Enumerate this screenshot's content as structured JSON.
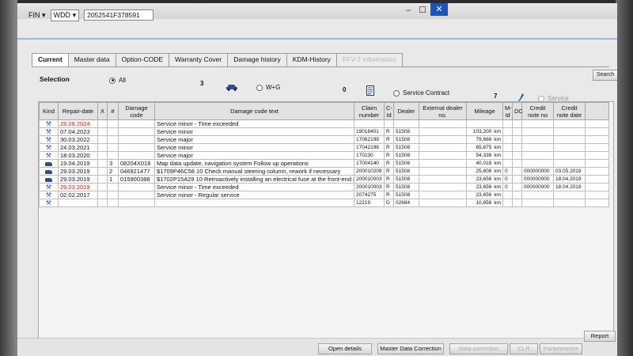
{
  "window": {
    "minimize": "–",
    "maximize": "☐",
    "close": "✕"
  },
  "vehicle": {
    "fin_label": "FIN",
    "wdd_value": "WDD",
    "vin": "2052541F378591"
  },
  "tabs": [
    "Current",
    "Master data",
    "Option-CODE",
    "Warranty Cover",
    "Damage history",
    "KDM-History",
    "FFV-T information"
  ],
  "active_tab": "Damage history",
  "selection": {
    "label": "Selection",
    "all": "All",
    "wg_count": "3",
    "wg_label": "W+G",
    "contract_count": "0",
    "contract_label": "Service Contract",
    "service_count": "7",
    "service_label": "Service"
  },
  "search_button": "Search",
  "table": {
    "headers": {
      "kind": "Kind",
      "repair_date": "Repair-date",
      "x": "X",
      "num": "#",
      "damage_code": "Damage code",
      "damage_text": "Damage code text",
      "claim": "Claim number",
      "cat": "C-Id",
      "dealer": "Dealer",
      "ext_dealer": "External dealer no.",
      "mileage": "Mileage",
      "m_id": "M-Id",
      "dc": "DC",
      "credit_note_no": "Credit note no",
      "credit_note_date": "Credit note date"
    },
    "rows": [
      {
        "kind": "service",
        "date": "28.08.2024",
        "date_red": true,
        "x": "",
        "num": "",
        "code": "",
        "text": "Service minor - Time exceeded",
        "claim": "",
        "cat": "",
        "dealer": "",
        "mileage": "",
        "unit": "",
        "mid": "",
        "credit_no": "",
        "credit_date": ""
      },
      {
        "kind": "service",
        "date": "07.04.2023",
        "date_red": false,
        "x": "",
        "num": "",
        "code": "",
        "text": "Service minor",
        "claim": "19018401",
        "cat": "R",
        "dealer": "51508",
        "mileage": "103,200",
        "unit": "km",
        "mid": "",
        "credit_no": "",
        "credit_date": ""
      },
      {
        "kind": "service",
        "date": "30.03.2022",
        "date_red": false,
        "x": "",
        "num": "",
        "code": "",
        "text": "Service major",
        "claim": "17062199",
        "cat": "R",
        "dealer": "51508",
        "mileage": "79,666",
        "unit": "km",
        "mid": "",
        "credit_no": "",
        "credit_date": ""
      },
      {
        "kind": "service",
        "date": "24.03.2021",
        "date_red": false,
        "x": "",
        "num": "",
        "code": "",
        "text": "Service minor",
        "claim": "17042198",
        "cat": "R",
        "dealer": "51508",
        "mileage": "65,875",
        "unit": "km",
        "mid": "",
        "credit_no": "",
        "credit_date": ""
      },
      {
        "kind": "service",
        "date": "18.03.2020",
        "date_red": false,
        "x": "",
        "num": "",
        "code": "",
        "text": "Service major",
        "claim": "170230",
        "cat": "R",
        "dealer": "51508",
        "mileage": "54,338",
        "unit": "km",
        "mid": "",
        "credit_no": "",
        "credit_date": ""
      },
      {
        "kind": "car",
        "date": "19.04.2019",
        "date_red": false,
        "x": "",
        "num": "3",
        "code": "08204X018",
        "text": "Map data update, navigation system Follow up operations",
        "claim": "17004140",
        "cat": "R",
        "dealer": "51508",
        "mileage": "40,018",
        "unit": "km",
        "mid": "",
        "credit_no": "",
        "credit_date": ""
      },
      {
        "kind": "car",
        "date": "29.03.2019",
        "date_red": false,
        "x": "",
        "num": "2",
        "code": "046921477",
        "text": "$1709P46C58 10 Check manual steering column, rework if necessary",
        "claim": "200010209",
        "cat": "R",
        "dealer": "51508",
        "mileage": "25,808",
        "unit": "km",
        "mid": "0",
        "credit_no": "000000000",
        "credit_date": "03.05.2019"
      },
      {
        "kind": "car",
        "date": "29.03.2019",
        "date_red": false,
        "x": "",
        "num": "1",
        "code": "015900388",
        "text": "$1702P15A29 10 Retroactively installing an electrical fuse at the front-end rela",
        "claim": "200010003",
        "cat": "R",
        "dealer": "51508",
        "mileage": "23,656",
        "unit": "km",
        "mid": "0",
        "credit_no": "000000000",
        "credit_date": "18.04.2019"
      },
      {
        "kind": "service",
        "date": "29.03.2019",
        "date_red": true,
        "x": "",
        "num": "",
        "code": "",
        "text": "Service minor - Time exceeded",
        "claim": "200010003",
        "cat": "R",
        "dealer": "51508",
        "mileage": "23,656",
        "unit": "km",
        "mid": "0",
        "credit_no": "000000000",
        "credit_date": "18.04.2019"
      },
      {
        "kind": "service",
        "date": "02.02.2017",
        "date_red": false,
        "x": "",
        "num": "",
        "code": "",
        "text": "Service minor - Regular service",
        "claim": "2074275",
        "cat": "R",
        "dealer": "51508",
        "mileage": "23,656",
        "unit": "km",
        "mid": "",
        "credit_no": "",
        "credit_date": ""
      },
      {
        "kind": "service",
        "date": "",
        "date_red": false,
        "x": "",
        "num": "",
        "code": "",
        "text": "",
        "claim": "12219",
        "cat": "D",
        "dealer": "02684",
        "mileage": "10,856",
        "unit": "km",
        "mid": "",
        "credit_no": "",
        "credit_date": ""
      }
    ]
  },
  "buttons": {
    "open_details": "Open details",
    "master_data_correction": "Master Data Correction",
    "data_correction": "Data correction",
    "clr": "CLR",
    "parameterize": "Parameterize",
    "report": "Report"
  },
  "colors": {
    "accent": "#1b55b8",
    "red_date": "#d01b1b",
    "icon_blue": "#2a5aa8"
  }
}
